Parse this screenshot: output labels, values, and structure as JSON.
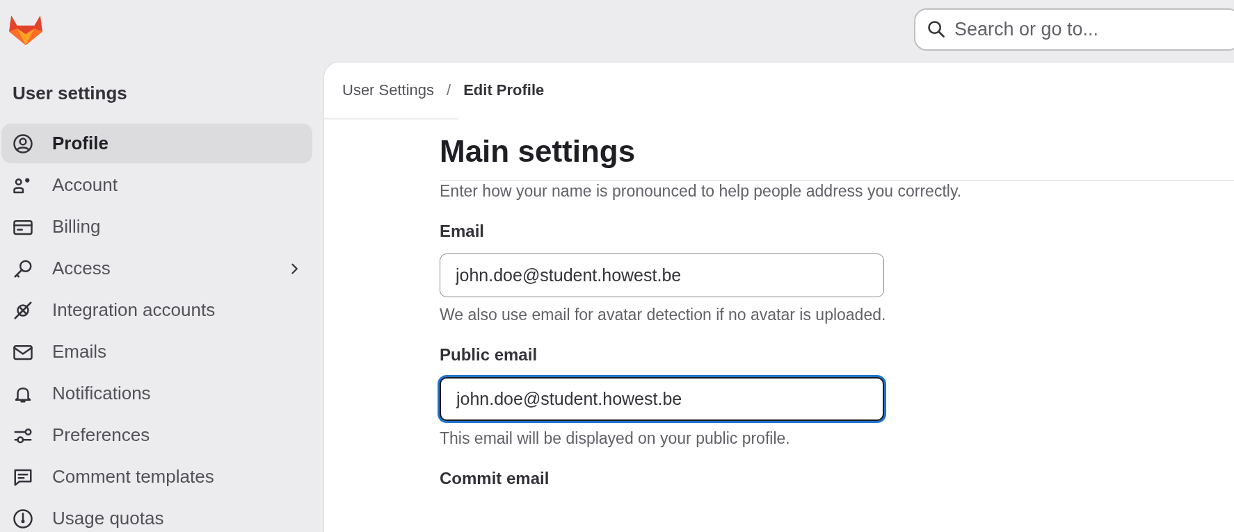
{
  "search": {
    "placeholder": "Search or go to..."
  },
  "sidebar": {
    "title": "User settings",
    "items": [
      {
        "label": "Profile",
        "selected": true
      },
      {
        "label": "Account",
        "selected": false
      },
      {
        "label": "Billing",
        "selected": false
      },
      {
        "label": "Access",
        "selected": false,
        "expandable": true
      },
      {
        "label": "Integration accounts",
        "selected": false
      },
      {
        "label": "Emails",
        "selected": false
      },
      {
        "label": "Notifications",
        "selected": false
      },
      {
        "label": "Preferences",
        "selected": false
      },
      {
        "label": "Comment templates",
        "selected": false
      },
      {
        "label": "Usage quotas",
        "selected": false
      }
    ]
  },
  "breadcrumb": [
    {
      "label": "User Settings",
      "current": false
    },
    {
      "label": "Edit Profile",
      "current": true
    }
  ],
  "breadcrumb_separator": "/",
  "heading": "Main settings",
  "intro_text": "Enter how your name is pronounced to help people address you correctly.",
  "fields": [
    {
      "label": "Email",
      "value": "john.doe@student.howest.be",
      "help": "We also use email for avatar detection if no avatar is uploaded.",
      "focused": false
    },
    {
      "label": "Public email",
      "value": "john.doe@student.howest.be",
      "help": "This email will be displayed on your public profile.",
      "focused": true
    },
    {
      "label": "Commit email"
    }
  ]
}
